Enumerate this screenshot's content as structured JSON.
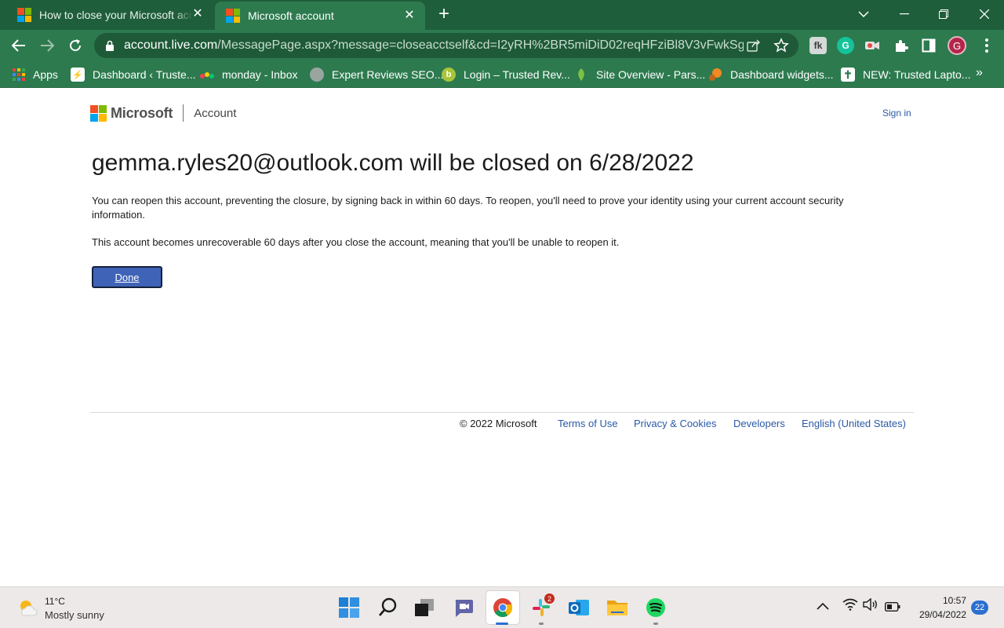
{
  "browser": {
    "tabs": [
      {
        "title": "How to close your Microsoft account",
        "active": false
      },
      {
        "title": "Microsoft account",
        "active": true
      }
    ],
    "new_tab_label": "+",
    "url": {
      "host": "account.live.com",
      "path": "/MessagePage.aspx?message=closeacctself&cd=I2yRH%2BR5miDiD02reqHFziBl8V3vFwkSgtyID..."
    },
    "profile_initial": "G",
    "bookmarks": [
      {
        "label": "Apps",
        "icon": "apps-grid-icon"
      },
      {
        "label": "Dashboard ‹ Truste...",
        "icon": "trusted-reviews-icon"
      },
      {
        "label": "monday - Inbox",
        "icon": "monday-icon"
      },
      {
        "label": "Expert Reviews SEO...",
        "icon": "globe-icon"
      },
      {
        "label": "Login – Trusted Rev...",
        "icon": "login-icon"
      },
      {
        "label": "Site Overview - Pars...",
        "icon": "parsely-icon"
      },
      {
        "label": "Dashboard widgets...",
        "icon": "widgets-icon"
      },
      {
        "label": "NEW: Trusted Lapto...",
        "icon": "cross-icon"
      }
    ],
    "bookmarks_more": "»"
  },
  "page": {
    "brand": "Microsoft",
    "section": "Account",
    "sign_in": "Sign in",
    "heading": "gemma.ryles20@outlook.com will be closed on 6/28/2022",
    "paragraph1": "You can reopen this account, preventing the closure, by signing back in within 60 days. To reopen, you'll need to prove your identity using your current account security information.",
    "paragraph2": "This account becomes unrecoverable 60 days after you close the account, meaning that you'll be unable to reopen it.",
    "done_button": "Done",
    "footer": {
      "copyright": "© 2022 Microsoft",
      "links": [
        "Terms of Use",
        "Privacy & Cookies",
        "Developers",
        "English (United States)"
      ]
    }
  },
  "taskbar": {
    "weather": {
      "temp": "11°C",
      "condition": "Mostly sunny"
    },
    "slack_badge": "2",
    "time": "10:57",
    "date": "29/04/2022",
    "notifications": "22"
  },
  "colors": {
    "chrome_frame": "#1f5e3b",
    "chrome_toolbar": "#2d7a4f",
    "done_button": "#3f63b6",
    "link": "#2b5aa5"
  }
}
